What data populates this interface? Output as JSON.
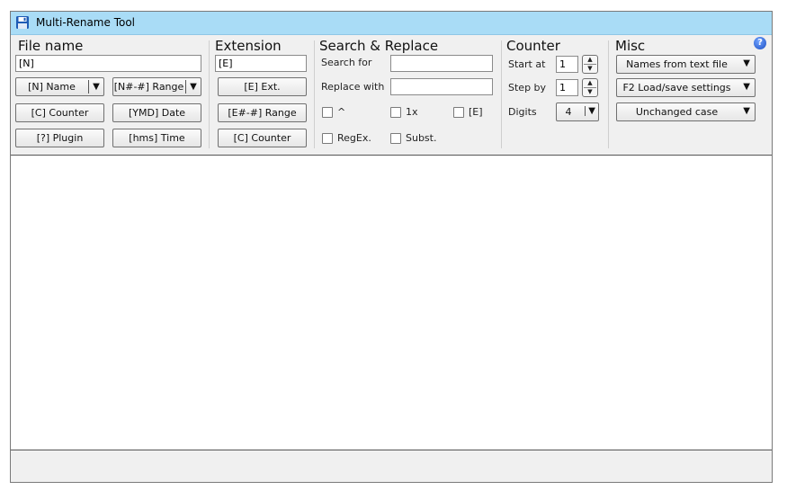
{
  "window": {
    "title": "Multi-Rename Tool",
    "app_icon": "floppy-disk-icon"
  },
  "file_name": {
    "title": "File name",
    "mask_value": "[N]",
    "name_button": "[N] Name",
    "range_button": "[N#-#] Range",
    "counter_button": "[C] Counter",
    "date_button": "[YMD] Date",
    "plugin_button": "[?] Plugin",
    "time_button": "[hms] Time"
  },
  "extension": {
    "title": "Extension",
    "mask_value": "[E]",
    "ext_button": "[E] Ext.",
    "range_button": "[E#-#] Range",
    "counter_button": "[C] Counter"
  },
  "search_replace": {
    "title": "Search & Replace",
    "search_label": "Search for",
    "search_value": "",
    "replace_label": "Replace with",
    "replace_value": "",
    "options": {
      "caret": "^",
      "once": "1x",
      "ext": "[E]",
      "regex": "RegEx.",
      "subst": "Subst."
    }
  },
  "counter": {
    "title": "Counter",
    "start_label": "Start at",
    "start_value": "1",
    "step_label": "Step by",
    "step_value": "1",
    "digits_label": "Digits",
    "digits_value": "4"
  },
  "misc": {
    "title": "Misc",
    "names_from_file": "Names from text file",
    "load_save": "F2 Load/save settings",
    "case": "Unchanged case",
    "help_icon": "?"
  },
  "icons": {
    "dropdown": "▼",
    "spin_up": "▲",
    "spin_down": "▼"
  }
}
